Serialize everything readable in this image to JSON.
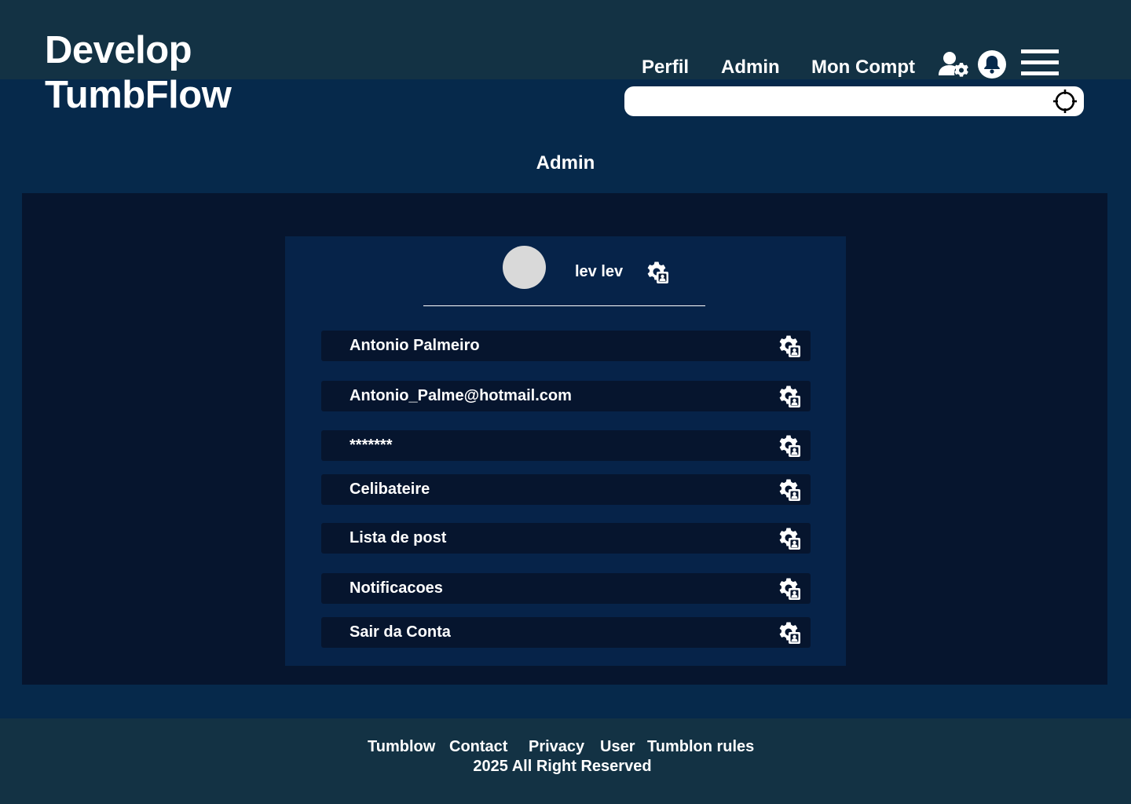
{
  "app": {
    "logo_line1": "Develop",
    "logo_line2": "TumbFlow"
  },
  "nav": {
    "perfil": "Perfil",
    "admin": "Admin",
    "account": "Mon Compt"
  },
  "header_icons": [
    "user-gear-icon",
    "bell-icon",
    "hamburger-menu-icon"
  ],
  "search": {
    "placeholder": "",
    "value": "",
    "icon": "crosshair-icon"
  },
  "page": {
    "title": "Admin"
  },
  "profile": {
    "name": "lev lev",
    "icon": "user-settings-icon"
  },
  "fields": [
    {
      "label": "Antonio Palmeiro"
    },
    {
      "label": "Antonio_Palme@hotmail.com"
    },
    {
      "label": "*******"
    },
    {
      "label": "Celibateire"
    },
    {
      "label": "Lista de post"
    },
    {
      "label": "Notificacoes"
    },
    {
      "label": "Sair da Conta"
    }
  ],
  "footer": {
    "links": [
      "Tumblow",
      "Contact",
      "Privacy",
      "User",
      "Tumblon rules"
    ],
    "copyright": "2025 All Right Reserved"
  },
  "colors": {
    "page_bg": "#06294b",
    "header_bg": "#133244",
    "panel_bg": "#06152e",
    "card_bg": "#062349",
    "text": "#ffffff",
    "avatar": "#d9d9d9"
  }
}
